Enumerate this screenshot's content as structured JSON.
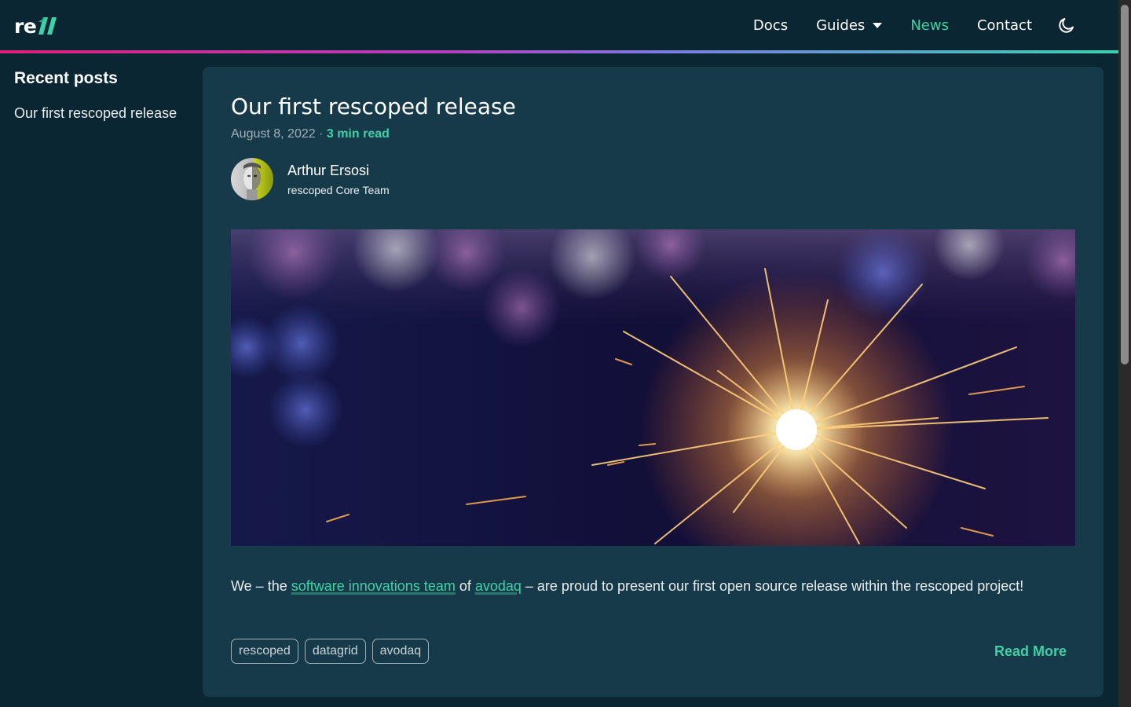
{
  "navbar": {
    "logo_text": "re",
    "links": [
      {
        "label": "Docs"
      },
      {
        "label": "Guides"
      },
      {
        "label": "News"
      },
      {
        "label": "Contact"
      }
    ],
    "active_link": "News",
    "theme_icon": "moon-icon",
    "accent_color": "#3fd0a6"
  },
  "sidebar": {
    "title": "Recent posts",
    "items": [
      {
        "label": "Our first rescoped release"
      }
    ]
  },
  "post": {
    "title": "Our first rescoped release",
    "date": "August 8, 2022",
    "separator": " · ",
    "read_time": "3 min read",
    "author": {
      "name": "Arthur Ersosi",
      "role": "rescoped Core Team"
    },
    "excerpt": {
      "part1": "We – the ",
      "link1": "software innovations team",
      "part2": " of ",
      "link2": "avodaq",
      "part3": " – are proud to present our first open source release within the rescoped project!"
    },
    "tags": [
      {
        "label": "rescoped"
      },
      {
        "label": "datagrid"
      },
      {
        "label": "avodaq"
      }
    ],
    "read_more": "Read More"
  }
}
